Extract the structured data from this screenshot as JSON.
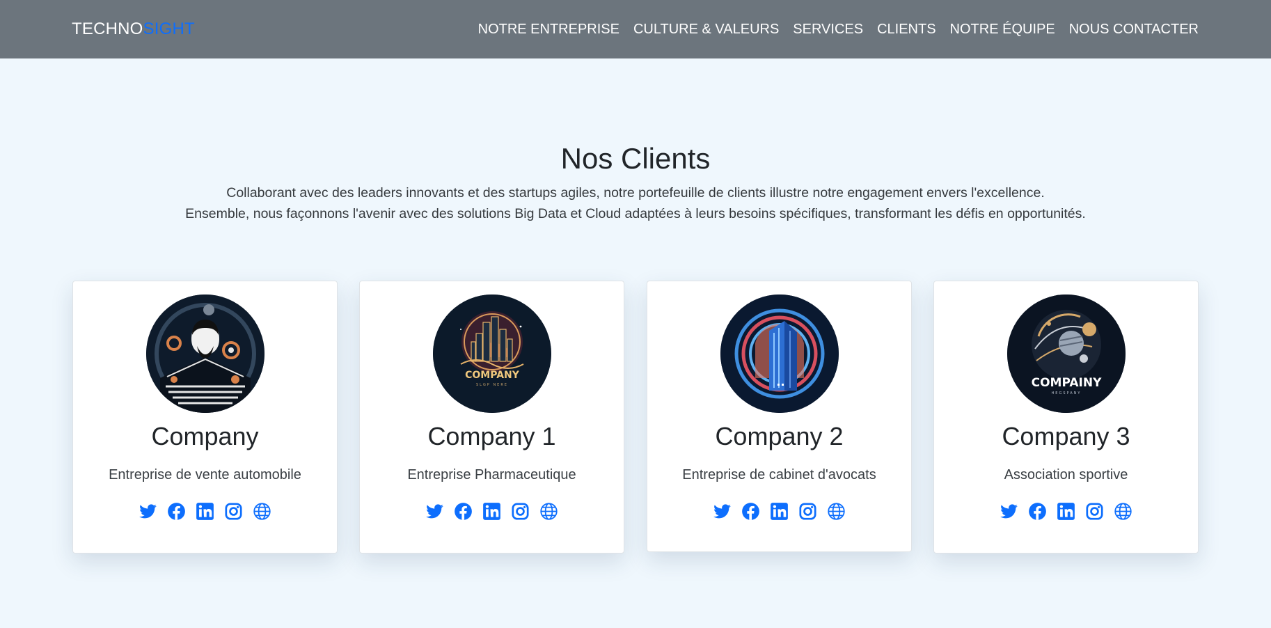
{
  "brand": {
    "part1": "TECHNO",
    "part2": "SIGHT"
  },
  "nav": [
    {
      "label": "NOTRE ENTREPRISE"
    },
    {
      "label": "CULTURE & VALEURS"
    },
    {
      "label": "SERVICES"
    },
    {
      "label": "CLIENTS"
    },
    {
      "label": "NOTRE ÉQUIPE"
    },
    {
      "label": "NOUS CONTACTER"
    }
  ],
  "section": {
    "title": "Nos Clients",
    "intro_line1": "Collaborant avec des leaders innovants et des startups agiles, notre portefeuille de clients illustre notre engagement envers l'excellence.",
    "intro_line2": "Ensemble, nous façonnons l'avenir avec des solutions Big Data et Cloud adaptées à leurs besoins spécifiques, transformant les défis en opportunités."
  },
  "clients": [
    {
      "name": "Company",
      "description": "Entreprise de vente automobile"
    },
    {
      "name": "Company 1",
      "description": "Entreprise Pharmaceutique",
      "logo_text": "COMPANY",
      "logo_subtext": "SLGP NERE"
    },
    {
      "name": "Company 2",
      "description": "Entreprise de cabinet d'avocats"
    },
    {
      "name": "Company 3",
      "description": "Association sportive",
      "logo_text": "COMPAINY",
      "logo_subtext": "HEGSPANY"
    }
  ],
  "social_icons": [
    "twitter-icon",
    "facebook-icon",
    "linkedin-icon",
    "instagram-icon",
    "globe-icon"
  ],
  "colors": {
    "navbar_bg": "#6c757d",
    "page_bg": "#eff7fd",
    "accent": "#0d6efd",
    "card_bg": "#ffffff",
    "logo_bg": "#0b1626"
  }
}
